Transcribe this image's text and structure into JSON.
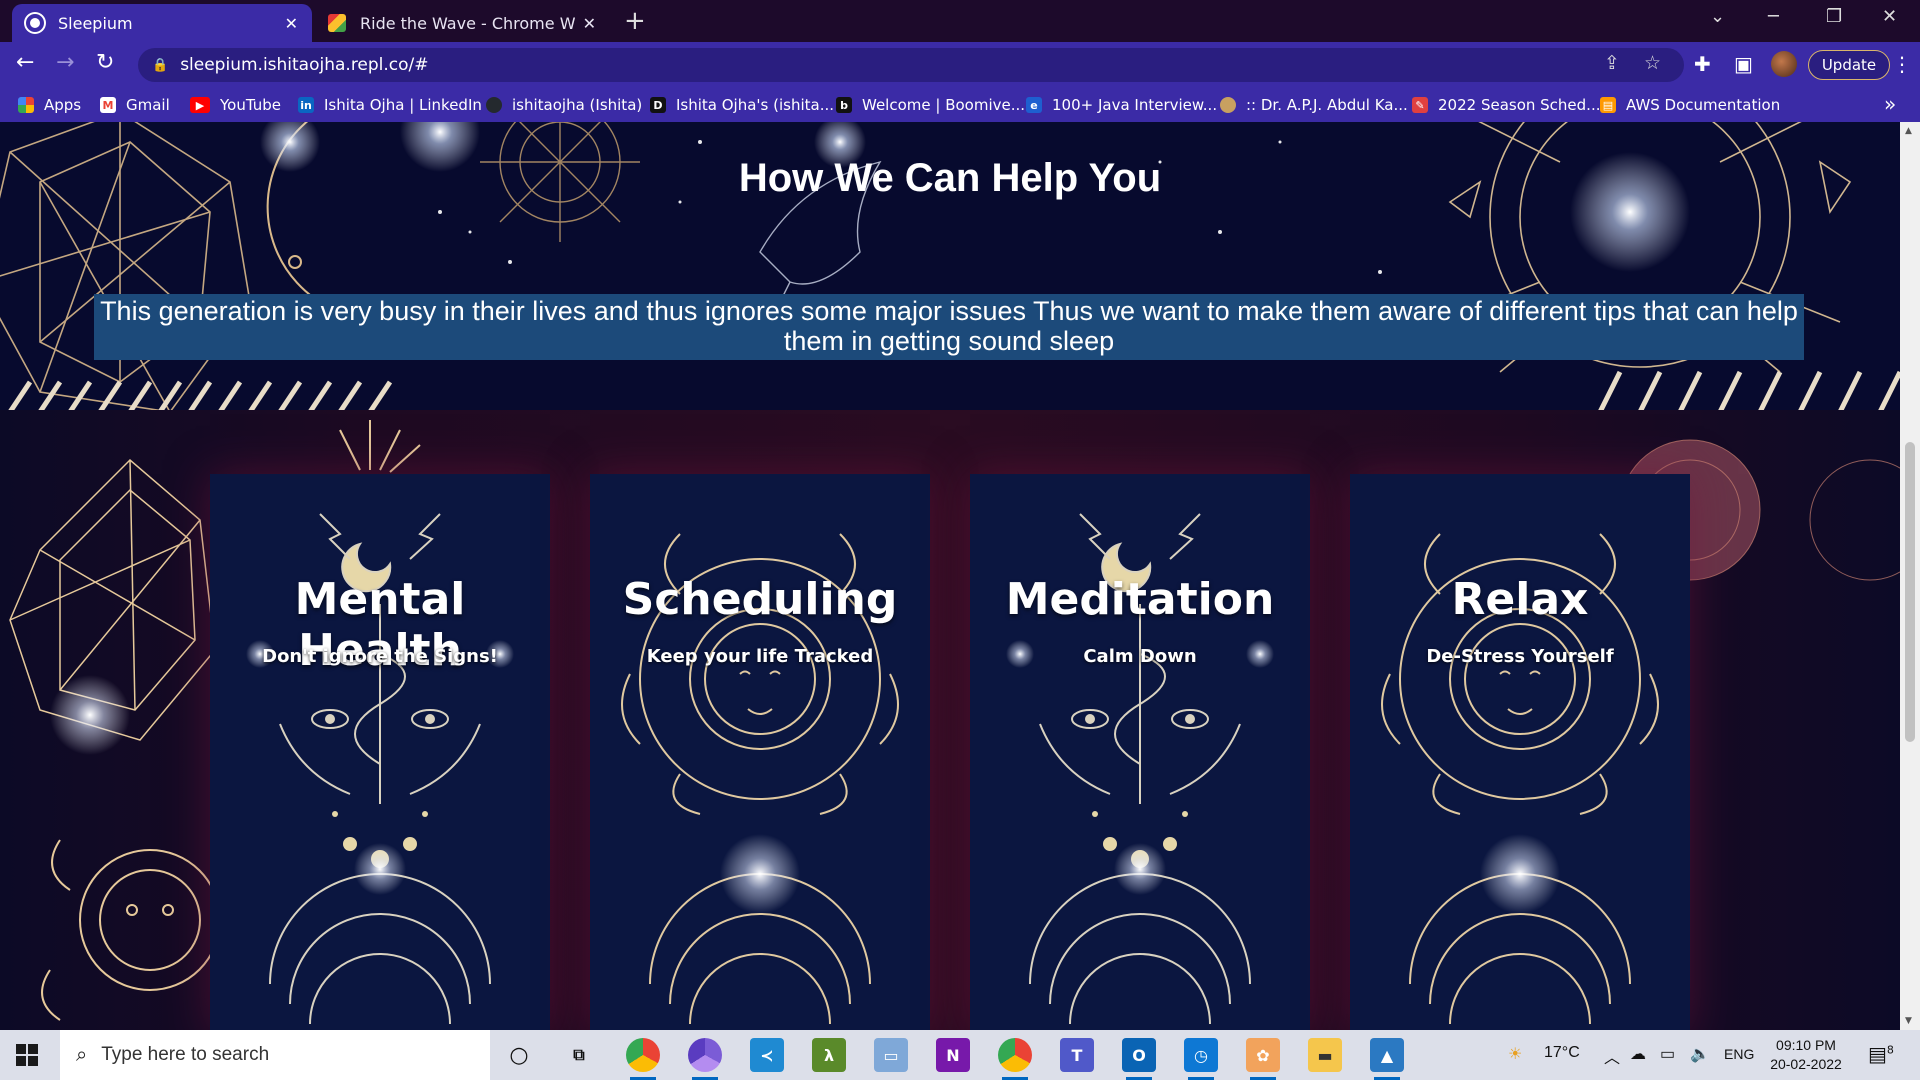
{
  "browser": {
    "tabs": [
      {
        "title": "Sleepium",
        "active": true,
        "favicon": "globe-icon"
      },
      {
        "title": "Ride the Wave - Chrome Web Sto",
        "active": false,
        "favicon": "chrome-web-store-icon"
      }
    ],
    "new_tab_label": "+",
    "url": "sleepium.ishitaojha.repl.co/#",
    "update_label": "Update",
    "bookmarks": [
      {
        "label": "Apps",
        "icon": "apps-grid-icon",
        "color": "#f4b400"
      },
      {
        "label": "Gmail",
        "icon": "gmail-icon",
        "color": "#ea4335"
      },
      {
        "label": "YouTube",
        "icon": "youtube-icon",
        "color": "#ff0000"
      },
      {
        "label": "Ishita Ojha | LinkedIn",
        "icon": "linkedin-icon",
        "color": "#0a66c2"
      },
      {
        "label": "ishitaojha (Ishita)",
        "icon": "github-icon",
        "color": "#24292e"
      },
      {
        "label": "Ishita Ojha's (ishita...",
        "icon": "dev-icon",
        "color": "#111111"
      },
      {
        "label": "Welcome | Boomive...",
        "icon": "boomive-icon",
        "color": "#111111"
      },
      {
        "label": "100+ Java Interview...",
        "icon": "java-site-icon",
        "color": "#1e5fd0"
      },
      {
        "label": ":: Dr. A.P.J. Abdul Ka...",
        "icon": "portrait-icon",
        "color": "#c8a060"
      },
      {
        "label": "2022 Season Sched...",
        "icon": "schedule-icon",
        "color": "#e04040"
      },
      {
        "label": "AWS Documentation",
        "icon": "aws-icon",
        "color": "#ff9900"
      }
    ]
  },
  "hero": {
    "title": "How We Can Help You",
    "text": "This generation is very busy in their lives and thus ignores some major issues Thus we want to make them aware of different tips that can help them in getting sound sleep"
  },
  "cards": [
    {
      "title": "Mental Health",
      "subtitle": "Don't ignore the Signs!",
      "art": "moon-snake-art"
    },
    {
      "title": "Scheduling",
      "subtitle": "Keep your life Tracked",
      "art": "sun-face-art"
    },
    {
      "title": "Meditation",
      "subtitle": "Calm Down",
      "art": "moon-snake-art"
    },
    {
      "title": "Relax",
      "subtitle": "De-Stress Yourself",
      "art": "sun-face-art"
    }
  ],
  "taskbar": {
    "search_placeholder": "Type here to search",
    "weather": "17°C",
    "language": "ENG",
    "time": "09:10 PM",
    "date": "20-02-2022",
    "notification_count": "8"
  },
  "colors": {
    "tab_active": "#3b2ba6",
    "tabbar": "#1d0a2b",
    "hero_highlight": "#1c4a7a",
    "card_bg": "#0b1640",
    "gold": "#d9b98a"
  }
}
